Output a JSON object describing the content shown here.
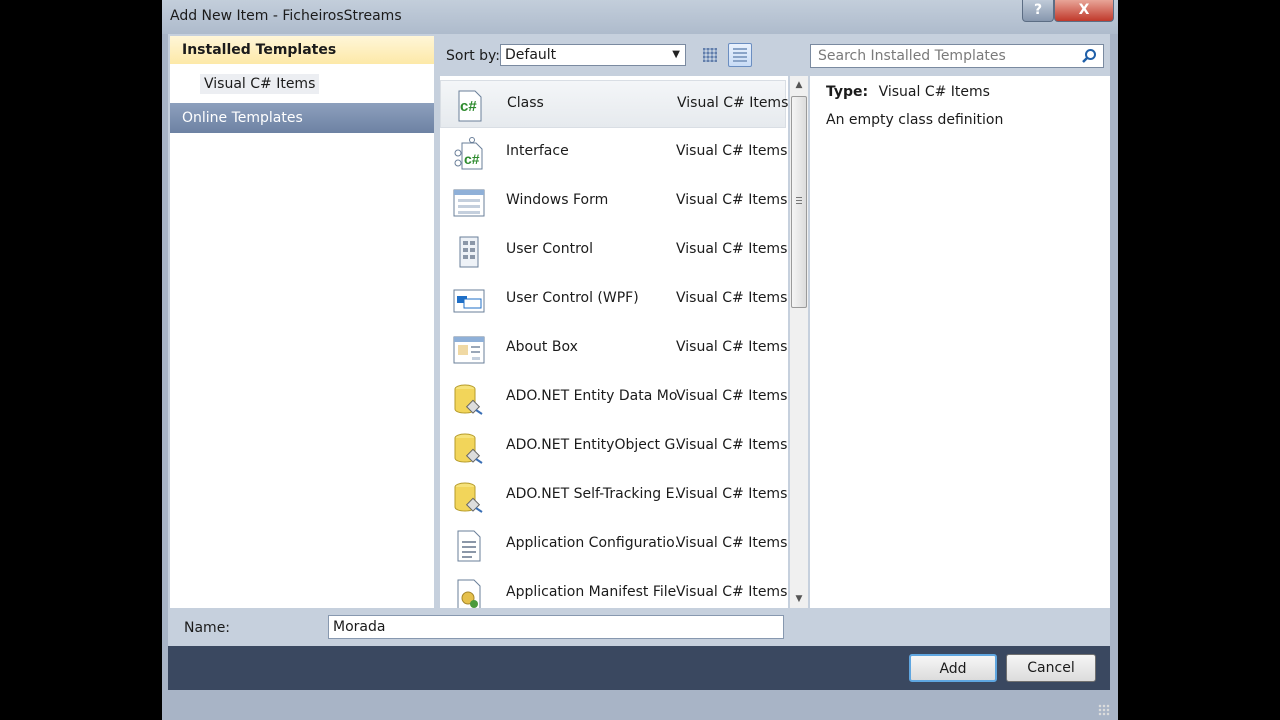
{
  "window": {
    "title": "Add New Item - FicheirosStreams",
    "help_label": "?",
    "close_label": "X"
  },
  "left_pane": {
    "installed_header": "Installed Templates",
    "installed_item": "Visual C# Items",
    "online_templates": "Online Templates"
  },
  "toolbar": {
    "sort_label": "Sort by:",
    "sort_value": "Default",
    "search_placeholder": "Search Installed Templates"
  },
  "templates": [
    {
      "name": "Class",
      "category": "Visual C# Items",
      "icon": "class-icon",
      "selected": true
    },
    {
      "name": "Interface",
      "category": "Visual C# Items",
      "icon": "interface-icon"
    },
    {
      "name": "Windows Form",
      "category": "Visual C# Items",
      "icon": "windows-form-icon"
    },
    {
      "name": "User Control",
      "category": "Visual C# Items",
      "icon": "user-control-icon"
    },
    {
      "name": "User Control (WPF)",
      "category": "Visual C# Items",
      "icon": "wpf-control-icon"
    },
    {
      "name": "About Box",
      "category": "Visual C# Items",
      "icon": "about-box-icon"
    },
    {
      "name": "ADO.NET Entity Data Mo...",
      "category": "Visual C# Items",
      "icon": "database-icon"
    },
    {
      "name": "ADO.NET EntityObject G...",
      "category": "Visual C# Items",
      "icon": "database-icon"
    },
    {
      "name": "ADO.NET Self-Tracking E...",
      "category": "Visual C# Items",
      "icon": "database-icon"
    },
    {
      "name": "Application Configuratio...",
      "category": "Visual C# Items",
      "icon": "config-file-icon"
    },
    {
      "name": "Application Manifest File",
      "category": "Visual C# Items",
      "icon": "manifest-file-icon"
    }
  ],
  "description": {
    "type_label": "Type:",
    "type_value": "Visual C# Items",
    "text": "An empty class definition"
  },
  "name_field": {
    "label": "Name:",
    "value": "Morada"
  },
  "buttons": {
    "add": "Add",
    "cancel": "Cancel"
  },
  "colors": {
    "accent": "#6d82a3",
    "selection_header": "#fde9a8"
  }
}
